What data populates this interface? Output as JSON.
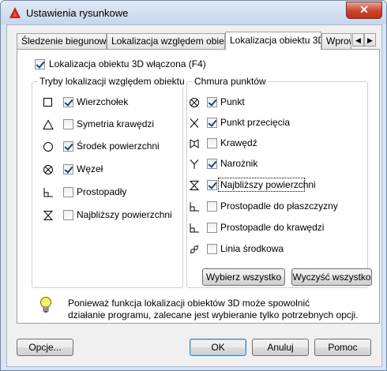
{
  "window": {
    "title": "Ustawienia rysunkowe",
    "close_glyph": "✕"
  },
  "tabs": {
    "items": [
      {
        "label": "Śledzenie biegunowe"
      },
      {
        "label": "Lokalizacja względem obiektu"
      },
      {
        "label": "Lokalizacja obiektu 3D"
      },
      {
        "label": "Wprow"
      }
    ],
    "scroll_left": "◀",
    "scroll_right": "▶"
  },
  "main_toggle": {
    "label": "Lokalizacja obiektu 3D włączona (F4)",
    "checked": true
  },
  "left_group": {
    "title": "Tryby lokalizacji względem obiektu",
    "items": [
      {
        "label": "Wierzchołek",
        "checked": true,
        "icon": "square-icon"
      },
      {
        "label": "Symetria krawędzi",
        "checked": false,
        "icon": "triangle-icon"
      },
      {
        "label": "Środek powierzchni",
        "checked": true,
        "icon": "circle-icon"
      },
      {
        "label": "Węzeł",
        "checked": true,
        "icon": "node-icon"
      },
      {
        "label": "Prostopadły",
        "checked": false,
        "icon": "perpendicular-icon"
      },
      {
        "label": "Najbliższy powierzchni",
        "checked": false,
        "icon": "nearest-icon"
      }
    ]
  },
  "right_group": {
    "title": "Chmura punktów",
    "items": [
      {
        "label": "Punkt",
        "checked": true,
        "icon": "node-icon"
      },
      {
        "label": "Punkt przecięcia",
        "checked": true,
        "icon": "intersection-icon"
      },
      {
        "label": "Krawędź",
        "checked": false,
        "icon": "edge-icon"
      },
      {
        "label": "Narożnik",
        "checked": true,
        "icon": "corner-icon"
      },
      {
        "label": "Najbliższy powierzchni",
        "checked": true,
        "icon": "nearest-icon"
      },
      {
        "label": "Prostopadle do płaszczyzny",
        "checked": false,
        "icon": "perpendicular-icon"
      },
      {
        "label": "Prostopadle do krawędzi",
        "checked": false,
        "icon": "perpendicular-icon"
      },
      {
        "label": "Linia środkowa",
        "checked": false,
        "icon": "centerline-icon"
      }
    ]
  },
  "select_all_label": "Wybierz wszystko",
  "clear_all_label": "Wyczyść wszystko",
  "info": {
    "line1": "Ponieważ funkcja lokalizacji obiektów 3D może spowolnić",
    "line2": "działanie programu, zalecane jest wybieranie tylko potrzebnych opcji."
  },
  "footer": {
    "options_label": "Opcje...",
    "ok_label": "OK",
    "cancel_label": "Anuluj",
    "help_label": "Pomoc"
  }
}
